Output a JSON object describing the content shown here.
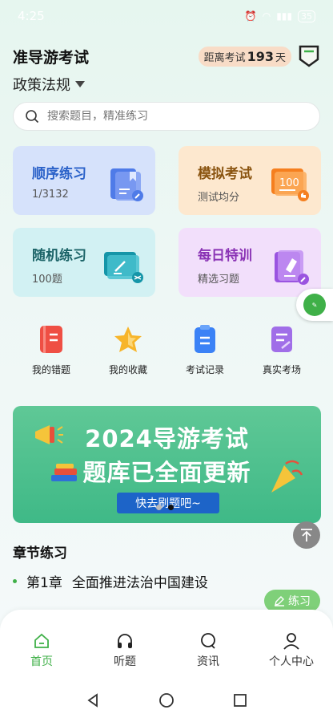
{
  "status": {
    "time": "4:25",
    "battery": "35"
  },
  "header": {
    "title": "准导游考试",
    "countdown_prefix": "距离考试",
    "countdown_days": "193",
    "countdown_unit": "天"
  },
  "subject": {
    "label": "政策法规"
  },
  "search": {
    "placeholder": "搜索题目，精准练习"
  },
  "cards": [
    {
      "title": "顺序练习",
      "sub": "1/3132"
    },
    {
      "title": "模拟考试",
      "sub": "测试均分",
      "icon_text": "100"
    },
    {
      "title": "随机练习",
      "sub": "100题"
    },
    {
      "title": "每日特训",
      "sub": "精选习题"
    }
  ],
  "quick": [
    {
      "label": "我的错题",
      "icon": "notebook-icon",
      "color": "#ef4f44"
    },
    {
      "label": "我的收藏",
      "icon": "star-icon",
      "color": "#f7b52b"
    },
    {
      "label": "考试记录",
      "icon": "clipboard-icon",
      "color": "#3b82f6"
    },
    {
      "label": "真实考场",
      "icon": "exam-paper-icon",
      "color": "#a06ee8"
    }
  ],
  "banner": {
    "line1": "2024导游考试",
    "line2": "题库已全面更新",
    "cta": "快去刷题吧~"
  },
  "section": {
    "title": "章节练习"
  },
  "chapter": {
    "num": "第1章",
    "name": "全面推进法治中国建设",
    "action": "练习"
  },
  "tabs": [
    {
      "label": "首页",
      "icon": "home-icon"
    },
    {
      "label": "听题",
      "icon": "headphones-icon"
    },
    {
      "label": "资讯",
      "icon": "chat-icon"
    },
    {
      "label": "个人中心",
      "icon": "user-icon"
    }
  ],
  "colors": {
    "accent": "#3fb048",
    "banner": "#4cc08e"
  }
}
